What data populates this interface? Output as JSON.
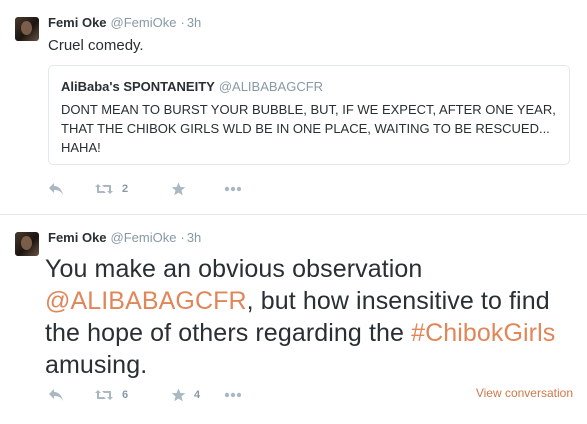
{
  "tweet1": {
    "fullname": "Femi Oke",
    "handle": "@FemiOke",
    "separator": "·",
    "time": "3h",
    "text": "Cruel comedy.",
    "quote": {
      "name": "AliBaba's SPONTANEITY",
      "handle": "@ALIBABAGCFR",
      "text": "DONT MEAN TO BURST YOUR BUBBLE, BUT, IF WE EXPECT, AFTER ONE YEAR, THAT THE CHIBOK GIRLS WLD BE IN ONE PLACE, WAITING TO BE RESCUED... HAHA!"
    },
    "retweet_count": "2",
    "favorite_count": ""
  },
  "tweet2": {
    "fullname": "Femi Oke",
    "handle": "@FemiOke",
    "separator": "·",
    "time": "3h",
    "text_part1": "You make an obvious observation ",
    "mention": "@ALIBABAGCFR",
    "text_part2": ", but how insensitive to find the hope of others regarding the ",
    "hashtag": "#ChibokGirls",
    "text_part3": " amusing.",
    "retweet_count": "6",
    "favorite_count": "4",
    "view_conversation": "View conversation"
  },
  "colors": {
    "link": "#e0875a",
    "icon": "#8899a6",
    "divider": "#e1e8ed"
  },
  "icons": [
    "reply-icon",
    "retweet-icon",
    "favorite-star-icon",
    "more-dots-icon"
  ]
}
